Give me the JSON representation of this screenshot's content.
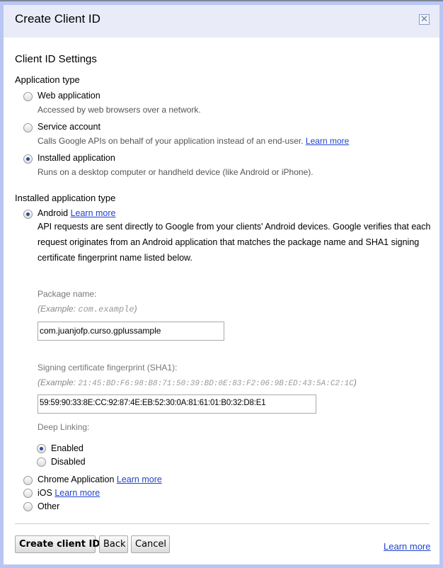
{
  "dialog": {
    "title": "Create Client ID",
    "close_icon": "close-icon"
  },
  "settings": {
    "heading": "Client ID Settings",
    "app_type_label": "Application type",
    "app_types": [
      {
        "label": "Web application",
        "desc": "Accessed by web browsers over a network.",
        "selected": false
      },
      {
        "label": "Service account",
        "desc": "Calls Google APIs on behalf of your application instead of an end-user.",
        "link": "Learn more",
        "selected": false
      },
      {
        "label": "Installed application",
        "desc": "Runs on a desktop computer or handheld device (like Android or iPhone).",
        "selected": true
      }
    ]
  },
  "installed": {
    "heading": "Installed application type",
    "android": {
      "label": "Android",
      "link": "Learn more",
      "selected": true,
      "description": "API requests are sent directly to Google from your clients' Android devices. Google verifies that each request originates from an Android application that matches the package name and SHA1 signing certificate fingerprint name listed below.",
      "package_label": "Package name:",
      "package_example_prefix": "(Example:",
      "package_example": "com.example",
      "package_example_suffix": ")",
      "package_value": "com.juanjofp.curso.gplussample",
      "sha1_label": "Signing certificate fingerprint (SHA1):",
      "sha1_example_prefix": "(Example:",
      "sha1_example": "21:45:BD:F6:98:B8:71:50:39:BD:0E:83:F2:06:9B:ED:43:5A:C2:1C",
      "sha1_example_suffix": ")",
      "sha1_value": "59:59:90:33:8E:CC:92:87:4E:EB:52:30:0A:81:61:01:B0:32:D8:E1",
      "deep_linking_label": "Deep Linking:",
      "deep_enabled": "Enabled",
      "deep_disabled": "Disabled",
      "deep_selected": "Enabled"
    },
    "others": [
      {
        "label": "Chrome Application",
        "link": "Learn more"
      },
      {
        "label": "iOS",
        "link": "Learn more"
      },
      {
        "label": "Other"
      }
    ]
  },
  "footer": {
    "create": "Create client ID",
    "back": "Back",
    "cancel": "Cancel",
    "learn_more": "Learn more"
  }
}
